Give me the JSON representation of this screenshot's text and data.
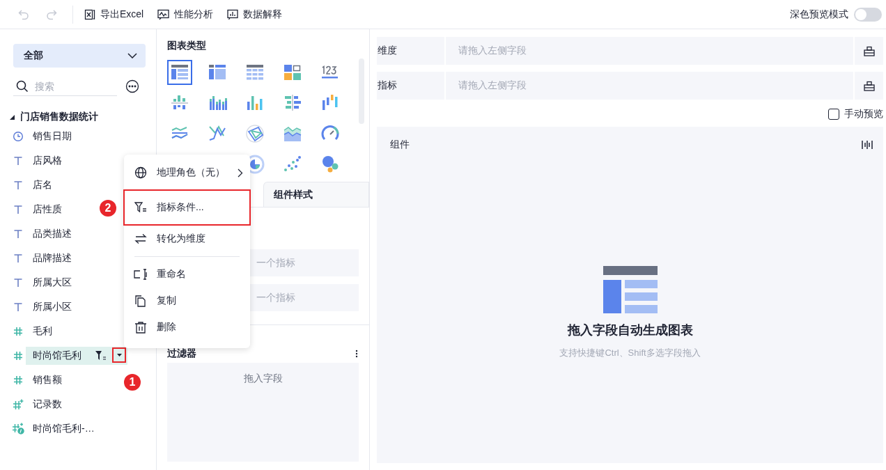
{
  "toolbar": {
    "undo": {
      "disabled": true
    },
    "redo": {
      "disabled": true
    },
    "actions": [
      {
        "kind": "excel",
        "label": "导出Excel"
      },
      {
        "kind": "performance",
        "label": "性能分析"
      },
      {
        "kind": "explain",
        "label": "数据解释"
      }
    ],
    "dark_preview": {
      "label": "深色预览模式",
      "on": false
    }
  },
  "field_panel": {
    "scope": "全部",
    "search": {
      "placeholder": "搜索"
    },
    "tree": [
      {
        "label": "门店销售数据统计",
        "expanded": true,
        "children": [
          {
            "kind": "date",
            "label": "销售日期",
            "selected": false
          },
          {
            "kind": "text",
            "label": "店风格",
            "selected": false
          },
          {
            "kind": "text",
            "label": "店名",
            "selected": false
          },
          {
            "kind": "text",
            "label": "店性质",
            "selected": false
          },
          {
            "kind": "text",
            "label": "品类描述",
            "selected": false
          },
          {
            "kind": "text",
            "label": "品牌描述",
            "selected": false
          },
          {
            "kind": "text",
            "label": "所属大区",
            "selected": false
          },
          {
            "kind": "text",
            "label": "所属小区",
            "selected": false
          },
          {
            "kind": "number",
            "label": "毛利",
            "selected": false
          },
          {
            "kind": "number",
            "label": "时尚馆毛利",
            "selected": true,
            "filtered": true
          },
          {
            "kind": "number",
            "label": "销售额",
            "selected": false
          },
          {
            "kind": "count",
            "label": "记录数",
            "selected": false
          },
          {
            "kind": "calc",
            "label": "时尚馆毛利-…",
            "selected": false
          }
        ]
      }
    ]
  },
  "chart_panel": {
    "title": "图表类型",
    "chart_types": [
      {
        "kind": "table",
        "selected": true
      },
      {
        "kind": "crosstable",
        "selected": false
      },
      {
        "kind": "detail",
        "selected": false
      },
      {
        "kind": "card",
        "selected": false
      },
      {
        "kind": "number",
        "selected": false
      },
      {
        "kind": "stack",
        "selected": false
      },
      {
        "kind": "group",
        "selected": false
      },
      {
        "kind": "bar",
        "selected": false
      },
      {
        "kind": "hbar",
        "selected": false
      },
      {
        "kind": "waterfall",
        "selected": false
      },
      {
        "kind": "line",
        "selected": false
      },
      {
        "kind": "cross",
        "selected": false
      },
      {
        "kind": "radar",
        "selected": false
      },
      {
        "kind": "area",
        "selected": false
      },
      {
        "kind": "gauge",
        "selected": false
      },
      {
        "kind": "hidden"
      },
      {
        "kind": "hidden"
      },
      {
        "kind": "pie",
        "selected": false
      },
      {
        "kind": "scatter",
        "selected": false
      },
      {
        "kind": "bubble",
        "selected": false
      }
    ],
    "tabs": [
      {
        "label": "组件样式",
        "selected": false
      }
    ],
    "metric_slots": [
      {
        "placeholder": "一个指标"
      },
      {
        "placeholder": "一个指标"
      }
    ],
    "filter": {
      "title": "过滤器",
      "drop_hint": "拖入字段"
    }
  },
  "config": {
    "rows": [
      {
        "label": "维度",
        "placeholder": "请拖入左侧字段"
      },
      {
        "label": "指标",
        "placeholder": "请拖入左侧字段"
      }
    ],
    "manual_preview": {
      "label": "手动预览",
      "checked": false
    },
    "component": {
      "title": "组件",
      "empty_title": "拖入字段自动生成图表",
      "empty_hint": "支持快捷键Ctrl、Shift多选字段拖入"
    }
  },
  "context_menu": {
    "items": [
      {
        "kind": "geo",
        "label": "地理角色（无）",
        "submenu": true,
        "highlighted": false
      },
      {
        "kind": "filter",
        "label": "指标条件...",
        "submenu": false,
        "highlighted": true
      },
      {
        "kind": "convert",
        "label": "转化为维度",
        "submenu": false,
        "highlighted": false
      },
      {
        "kind": "divider"
      },
      {
        "kind": "rename",
        "label": "重命名",
        "submenu": false,
        "highlighted": false
      },
      {
        "kind": "copy",
        "label": "复制",
        "submenu": false,
        "highlighted": false
      },
      {
        "kind": "delete",
        "label": "删除",
        "submenu": false,
        "highlighted": false
      }
    ]
  },
  "step_marks": [
    {
      "label": "1"
    },
    {
      "label": "2"
    }
  ]
}
